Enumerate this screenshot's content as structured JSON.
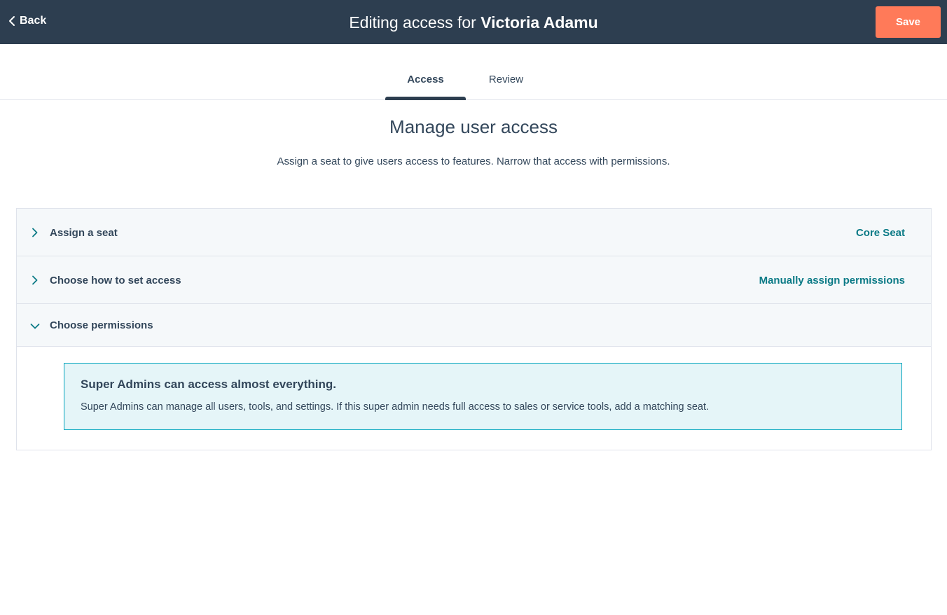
{
  "header": {
    "back_label": "Back",
    "title_prefix": "Editing access for",
    "user_name": "Victoria Adamu",
    "save_label": "Save"
  },
  "tabs": [
    {
      "label": "Access",
      "active": true
    },
    {
      "label": "Review",
      "active": false
    }
  ],
  "main": {
    "heading": "Manage user access",
    "subheading": "Assign a seat to give users access to features. Narrow that access with permissions."
  },
  "accordion": {
    "items": [
      {
        "label": "Assign a seat",
        "value": "Core Seat",
        "expanded": false,
        "icon": "chevron-right-icon"
      },
      {
        "label": "Choose how to set access",
        "value": "Manually assign permissions",
        "expanded": false,
        "icon": "chevron-right-icon"
      },
      {
        "label": "Choose permissions",
        "value": "",
        "expanded": true,
        "icon": "chevron-down-icon"
      }
    ]
  },
  "callout": {
    "title": "Super Admins can access almost everything.",
    "text": "Super Admins can manage all users, tools, and settings. If this super admin needs full access to sales or service tools, add a matching seat."
  },
  "colors": {
    "topbar": "#2d3e50",
    "save": "#ff7a59",
    "link": "#0b7a86",
    "callout_bg": "#e5f5f8",
    "callout_border": "#00a4bd"
  }
}
